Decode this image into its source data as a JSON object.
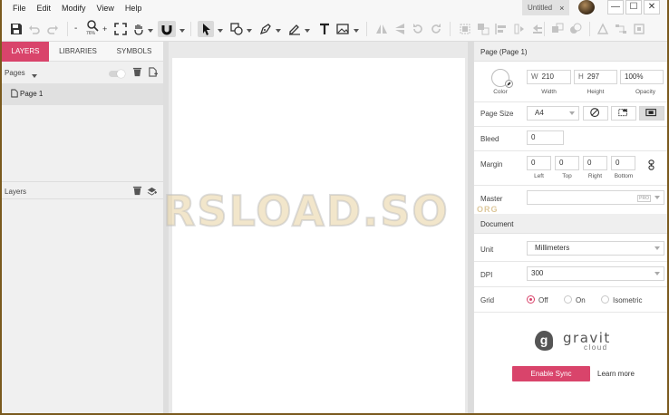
{
  "menu": [
    "File",
    "Edit",
    "Modify",
    "View",
    "Help"
  ],
  "document_tab": {
    "title": "Untitled",
    "close": "×"
  },
  "window_controls": {
    "minimize": "—",
    "maximize": "☐",
    "close": "✕"
  },
  "toolbar": {
    "zoom_level": "76%"
  },
  "left_panel": {
    "tabs": [
      "LAYERS",
      "LIBRARIES",
      "SYMBOLS"
    ],
    "active_tab": "LAYERS",
    "pages_label": "Pages",
    "pages": [
      {
        "name": "Page 1"
      }
    ],
    "layers_label": "Layers"
  },
  "right_panel": {
    "header": "Page (Page 1)",
    "color_caption": "Color",
    "width": {
      "prefix": "W",
      "value": "210",
      "caption": "Width"
    },
    "height": {
      "prefix": "H",
      "value": "297",
      "caption": "Height"
    },
    "opacity": {
      "value": "100%",
      "caption": "Opacity"
    },
    "page_size": {
      "label": "Page Size",
      "value": "A4"
    },
    "bleed": {
      "label": "Bleed",
      "value": "0"
    },
    "margin": {
      "label": "Margin",
      "left": {
        "value": "0",
        "caption": "Left"
      },
      "top": {
        "value": "0",
        "caption": "Top"
      },
      "right": {
        "value": "0",
        "caption": "Right"
      },
      "bottom": {
        "value": "0",
        "caption": "Bottom"
      }
    },
    "master": {
      "label": "Master",
      "badge": "PRO"
    },
    "document_header": "Document",
    "unit": {
      "label": "Unit",
      "value": "Millimeters"
    },
    "dpi": {
      "label": "DPI",
      "value": "300"
    },
    "grid": {
      "label": "Grid",
      "options": [
        "Off",
        "On",
        "Isometric"
      ],
      "selected": "Off"
    },
    "brand": {
      "name": "gravit",
      "sub": "cloud",
      "logo_letter": "g"
    },
    "enable_sync": "Enable Sync",
    "learn_more": "Learn more"
  },
  "watermark": {
    "text": "RSLOAD.SO",
    "sub": "ORG"
  },
  "colors": {
    "accent": "#d9446b"
  }
}
